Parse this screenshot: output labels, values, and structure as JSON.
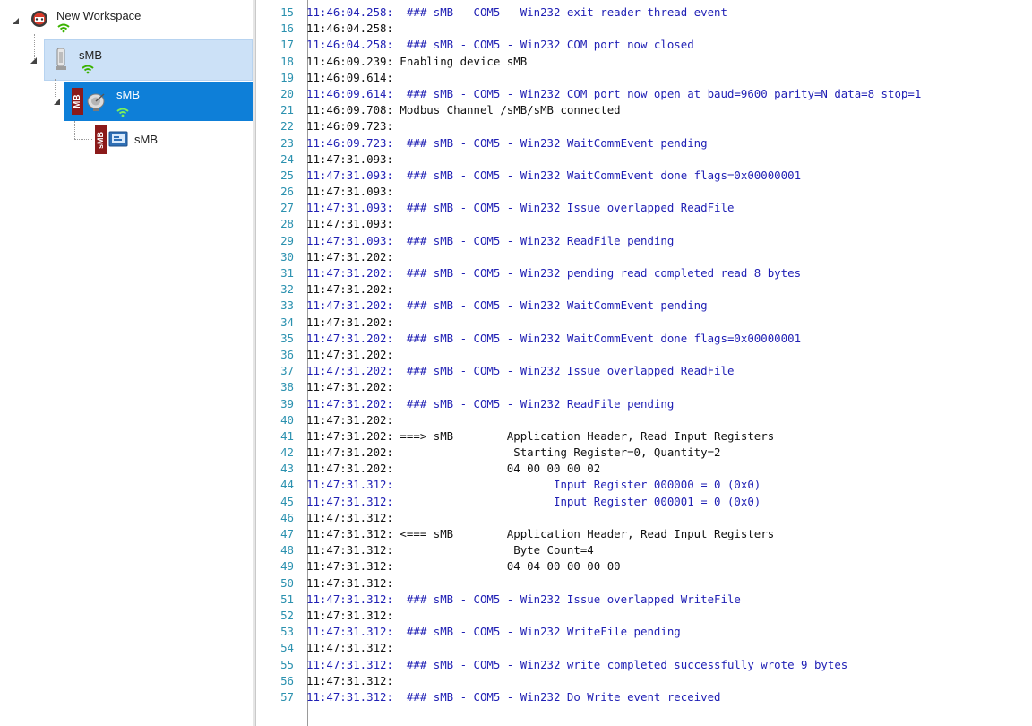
{
  "tree": {
    "workspace_label": "New Workspace",
    "channel_label": "sMB",
    "device_label": "sMB",
    "item_label": "sMB",
    "device_badge": "MB",
    "item_badge": "sMB"
  },
  "log": {
    "lines": [
      {
        "n": "15",
        "t": "11:46:04.258:  ### sMB - COM5 - Win232 exit reader thread event",
        "blue": true
      },
      {
        "n": "16",
        "t": "11:46:04.258:",
        "blue": false
      },
      {
        "n": "17",
        "t": "11:46:04.258:  ### sMB - COM5 - Win232 COM port now closed",
        "blue": true
      },
      {
        "n": "18",
        "t": "11:46:09.239: Enabling device sMB",
        "blue": false
      },
      {
        "n": "19",
        "t": "11:46:09.614:",
        "blue": false
      },
      {
        "n": "20",
        "t": "11:46:09.614:  ### sMB - COM5 - Win232 COM port now open at baud=9600 parity=N data=8 stop=1",
        "blue": true
      },
      {
        "n": "21",
        "t": "11:46:09.708: Modbus Channel /sMB/sMB connected",
        "blue": false
      },
      {
        "n": "22",
        "t": "11:46:09.723:",
        "blue": false
      },
      {
        "n": "23",
        "t": "11:46:09.723:  ### sMB - COM5 - Win232 WaitCommEvent pending",
        "blue": true
      },
      {
        "n": "24",
        "t": "11:47:31.093:",
        "blue": false
      },
      {
        "n": "25",
        "t": "11:47:31.093:  ### sMB - COM5 - Win232 WaitCommEvent done flags=0x00000001",
        "blue": true
      },
      {
        "n": "26",
        "t": "11:47:31.093:",
        "blue": false
      },
      {
        "n": "27",
        "t": "11:47:31.093:  ### sMB - COM5 - Win232 Issue overlapped ReadFile",
        "blue": true
      },
      {
        "n": "28",
        "t": "11:47:31.093:",
        "blue": false
      },
      {
        "n": "29",
        "t": "11:47:31.093:  ### sMB - COM5 - Win232 ReadFile pending",
        "blue": true
      },
      {
        "n": "30",
        "t": "11:47:31.202:",
        "blue": false
      },
      {
        "n": "31",
        "t": "11:47:31.202:  ### sMB - COM5 - Win232 pending read completed read 8 bytes",
        "blue": true
      },
      {
        "n": "32",
        "t": "11:47:31.202:",
        "blue": false
      },
      {
        "n": "33",
        "t": "11:47:31.202:  ### sMB - COM5 - Win232 WaitCommEvent pending",
        "blue": true
      },
      {
        "n": "34",
        "t": "11:47:31.202:",
        "blue": false
      },
      {
        "n": "35",
        "t": "11:47:31.202:  ### sMB - COM5 - Win232 WaitCommEvent done flags=0x00000001",
        "blue": true
      },
      {
        "n": "36",
        "t": "11:47:31.202:",
        "blue": false
      },
      {
        "n": "37",
        "t": "11:47:31.202:  ### sMB - COM5 - Win232 Issue overlapped ReadFile",
        "blue": true
      },
      {
        "n": "38",
        "t": "11:47:31.202:",
        "blue": false
      },
      {
        "n": "39",
        "t": "11:47:31.202:  ### sMB - COM5 - Win232 ReadFile pending",
        "blue": true
      },
      {
        "n": "40",
        "t": "11:47:31.202:",
        "blue": false
      },
      {
        "n": "41",
        "t": "11:47:31.202: ===> sMB        Application Header, Read Input Registers",
        "blue": false
      },
      {
        "n": "42",
        "t": "11:47:31.202:                  Starting Register=0, Quantity=2",
        "blue": false
      },
      {
        "n": "43",
        "t": "11:47:31.202:                 04 00 00 00 02",
        "blue": false
      },
      {
        "n": "44",
        "t": "11:47:31.312:                        Input Register 000000 = 0 (0x0)",
        "blue": true
      },
      {
        "n": "45",
        "t": "11:47:31.312:                        Input Register 000001 = 0 (0x0)",
        "blue": true
      },
      {
        "n": "46",
        "t": "11:47:31.312:",
        "blue": false
      },
      {
        "n": "47",
        "t": "11:47:31.312: <=== sMB        Application Header, Read Input Registers",
        "blue": false
      },
      {
        "n": "48",
        "t": "11:47:31.312:                  Byte Count=4",
        "blue": false
      },
      {
        "n": "49",
        "t": "11:47:31.312:                 04 04 00 00 00 00",
        "blue": false
      },
      {
        "n": "50",
        "t": "11:47:31.312:",
        "blue": false
      },
      {
        "n": "51",
        "t": "11:47:31.312:  ### sMB - COM5 - Win232 Issue overlapped WriteFile",
        "blue": true
      },
      {
        "n": "52",
        "t": "11:47:31.312:",
        "blue": false
      },
      {
        "n": "53",
        "t": "11:47:31.312:  ### sMB - COM5 - Win232 WriteFile pending",
        "blue": true
      },
      {
        "n": "54",
        "t": "11:47:31.312:",
        "blue": false
      },
      {
        "n": "55",
        "t": "11:47:31.312:  ### sMB - COM5 - Win232 write completed successfully wrote 9 bytes",
        "blue": true
      },
      {
        "n": "56",
        "t": "11:47:31.312:",
        "blue": false
      },
      {
        "n": "57",
        "t": "11:47:31.312:  ### sMB - COM5 - Win232 Do Write event received",
        "blue": true
      }
    ]
  },
  "colors": {
    "selection_light": "#cce1f7",
    "selection_strong": "#0e7fd8",
    "line_number": "#2b91af",
    "log_blue": "#1f1fb4",
    "wifi": "#3bb200",
    "badge": "#8b1a1a"
  }
}
